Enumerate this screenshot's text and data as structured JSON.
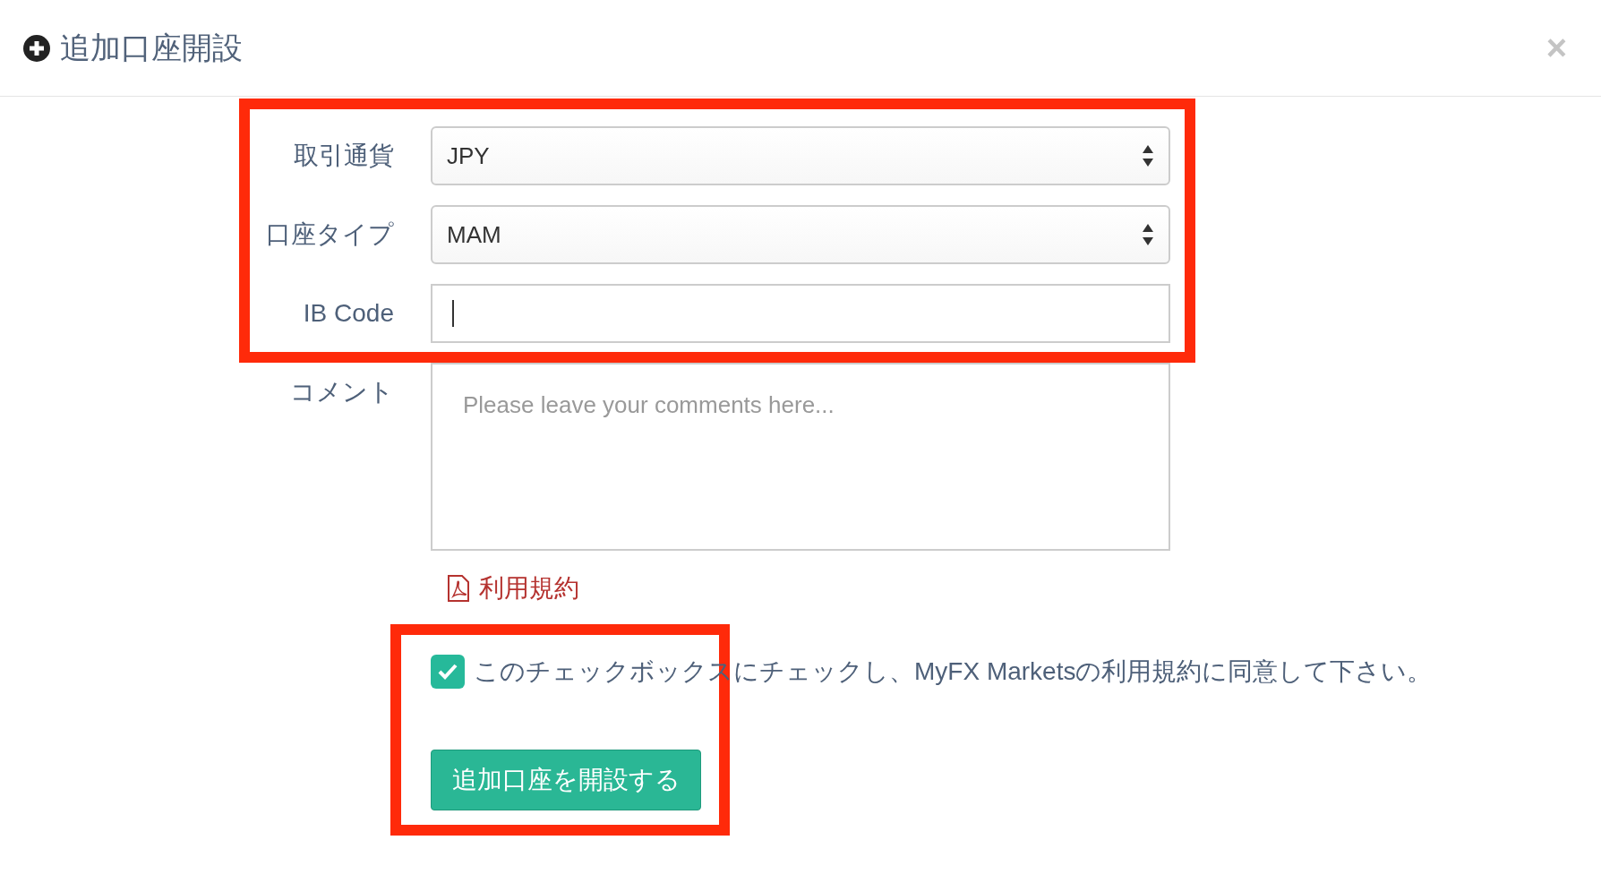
{
  "dialog": {
    "title": "追加口座開設",
    "close": "×"
  },
  "fields": [
    {
      "kind": "select",
      "label": "取引通貨",
      "value": "JPY"
    },
    {
      "kind": "select",
      "label": "口座タイプ",
      "value": "MAM"
    },
    {
      "kind": "input",
      "label": "IB Code",
      "focused": true
    },
    {
      "kind": "textarea",
      "label": "コメント",
      "placeholder": "Please leave your comments here..."
    }
  ],
  "terms_link": "利用規約",
  "agreement": {
    "checked": true,
    "text": "このチェックボックスにチェックし、MyFX Marketsの利用規約に同意して下さい。"
  },
  "submit_button": "追加口座を開設する"
}
